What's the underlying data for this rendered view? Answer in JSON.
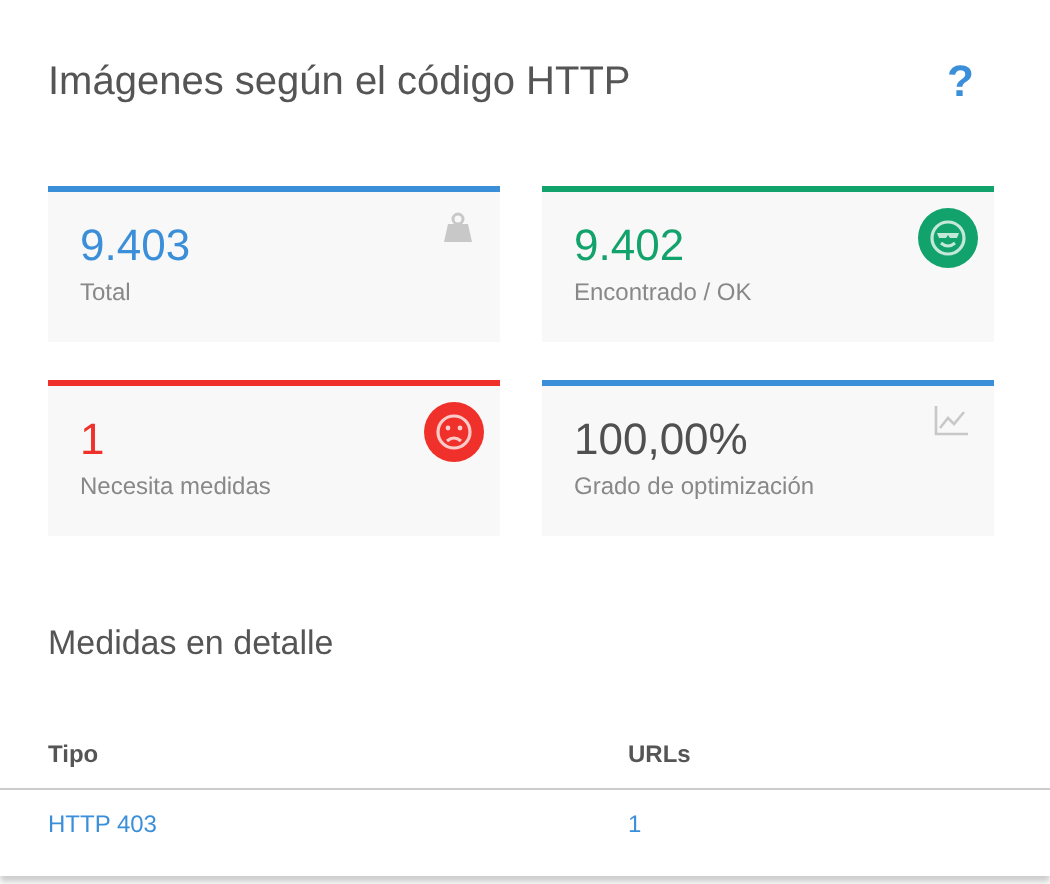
{
  "title": "Imágenes según el código HTTP",
  "help": "?",
  "cards": [
    {
      "value": "9.403",
      "label": "Total",
      "color": "#3b8fd9",
      "muted": false,
      "kind": "weight"
    },
    {
      "value": "9.402",
      "label": "Encontrado / OK",
      "color": "#12a36d",
      "muted": false,
      "kind": "cool-face"
    },
    {
      "value": "1",
      "label": "Necesita medidas",
      "color": "#f0302a",
      "muted": false,
      "kind": "sad-face"
    },
    {
      "value": "100,00%",
      "label": "Grado de optimización",
      "color": "#3b8fd9",
      "muted": true,
      "kind": "chart"
    }
  ],
  "section_title": "Medidas en detalle",
  "table": {
    "columns": [
      "Tipo",
      "URLs"
    ],
    "rows": [
      [
        "HTTP 403",
        "1"
      ]
    ]
  }
}
